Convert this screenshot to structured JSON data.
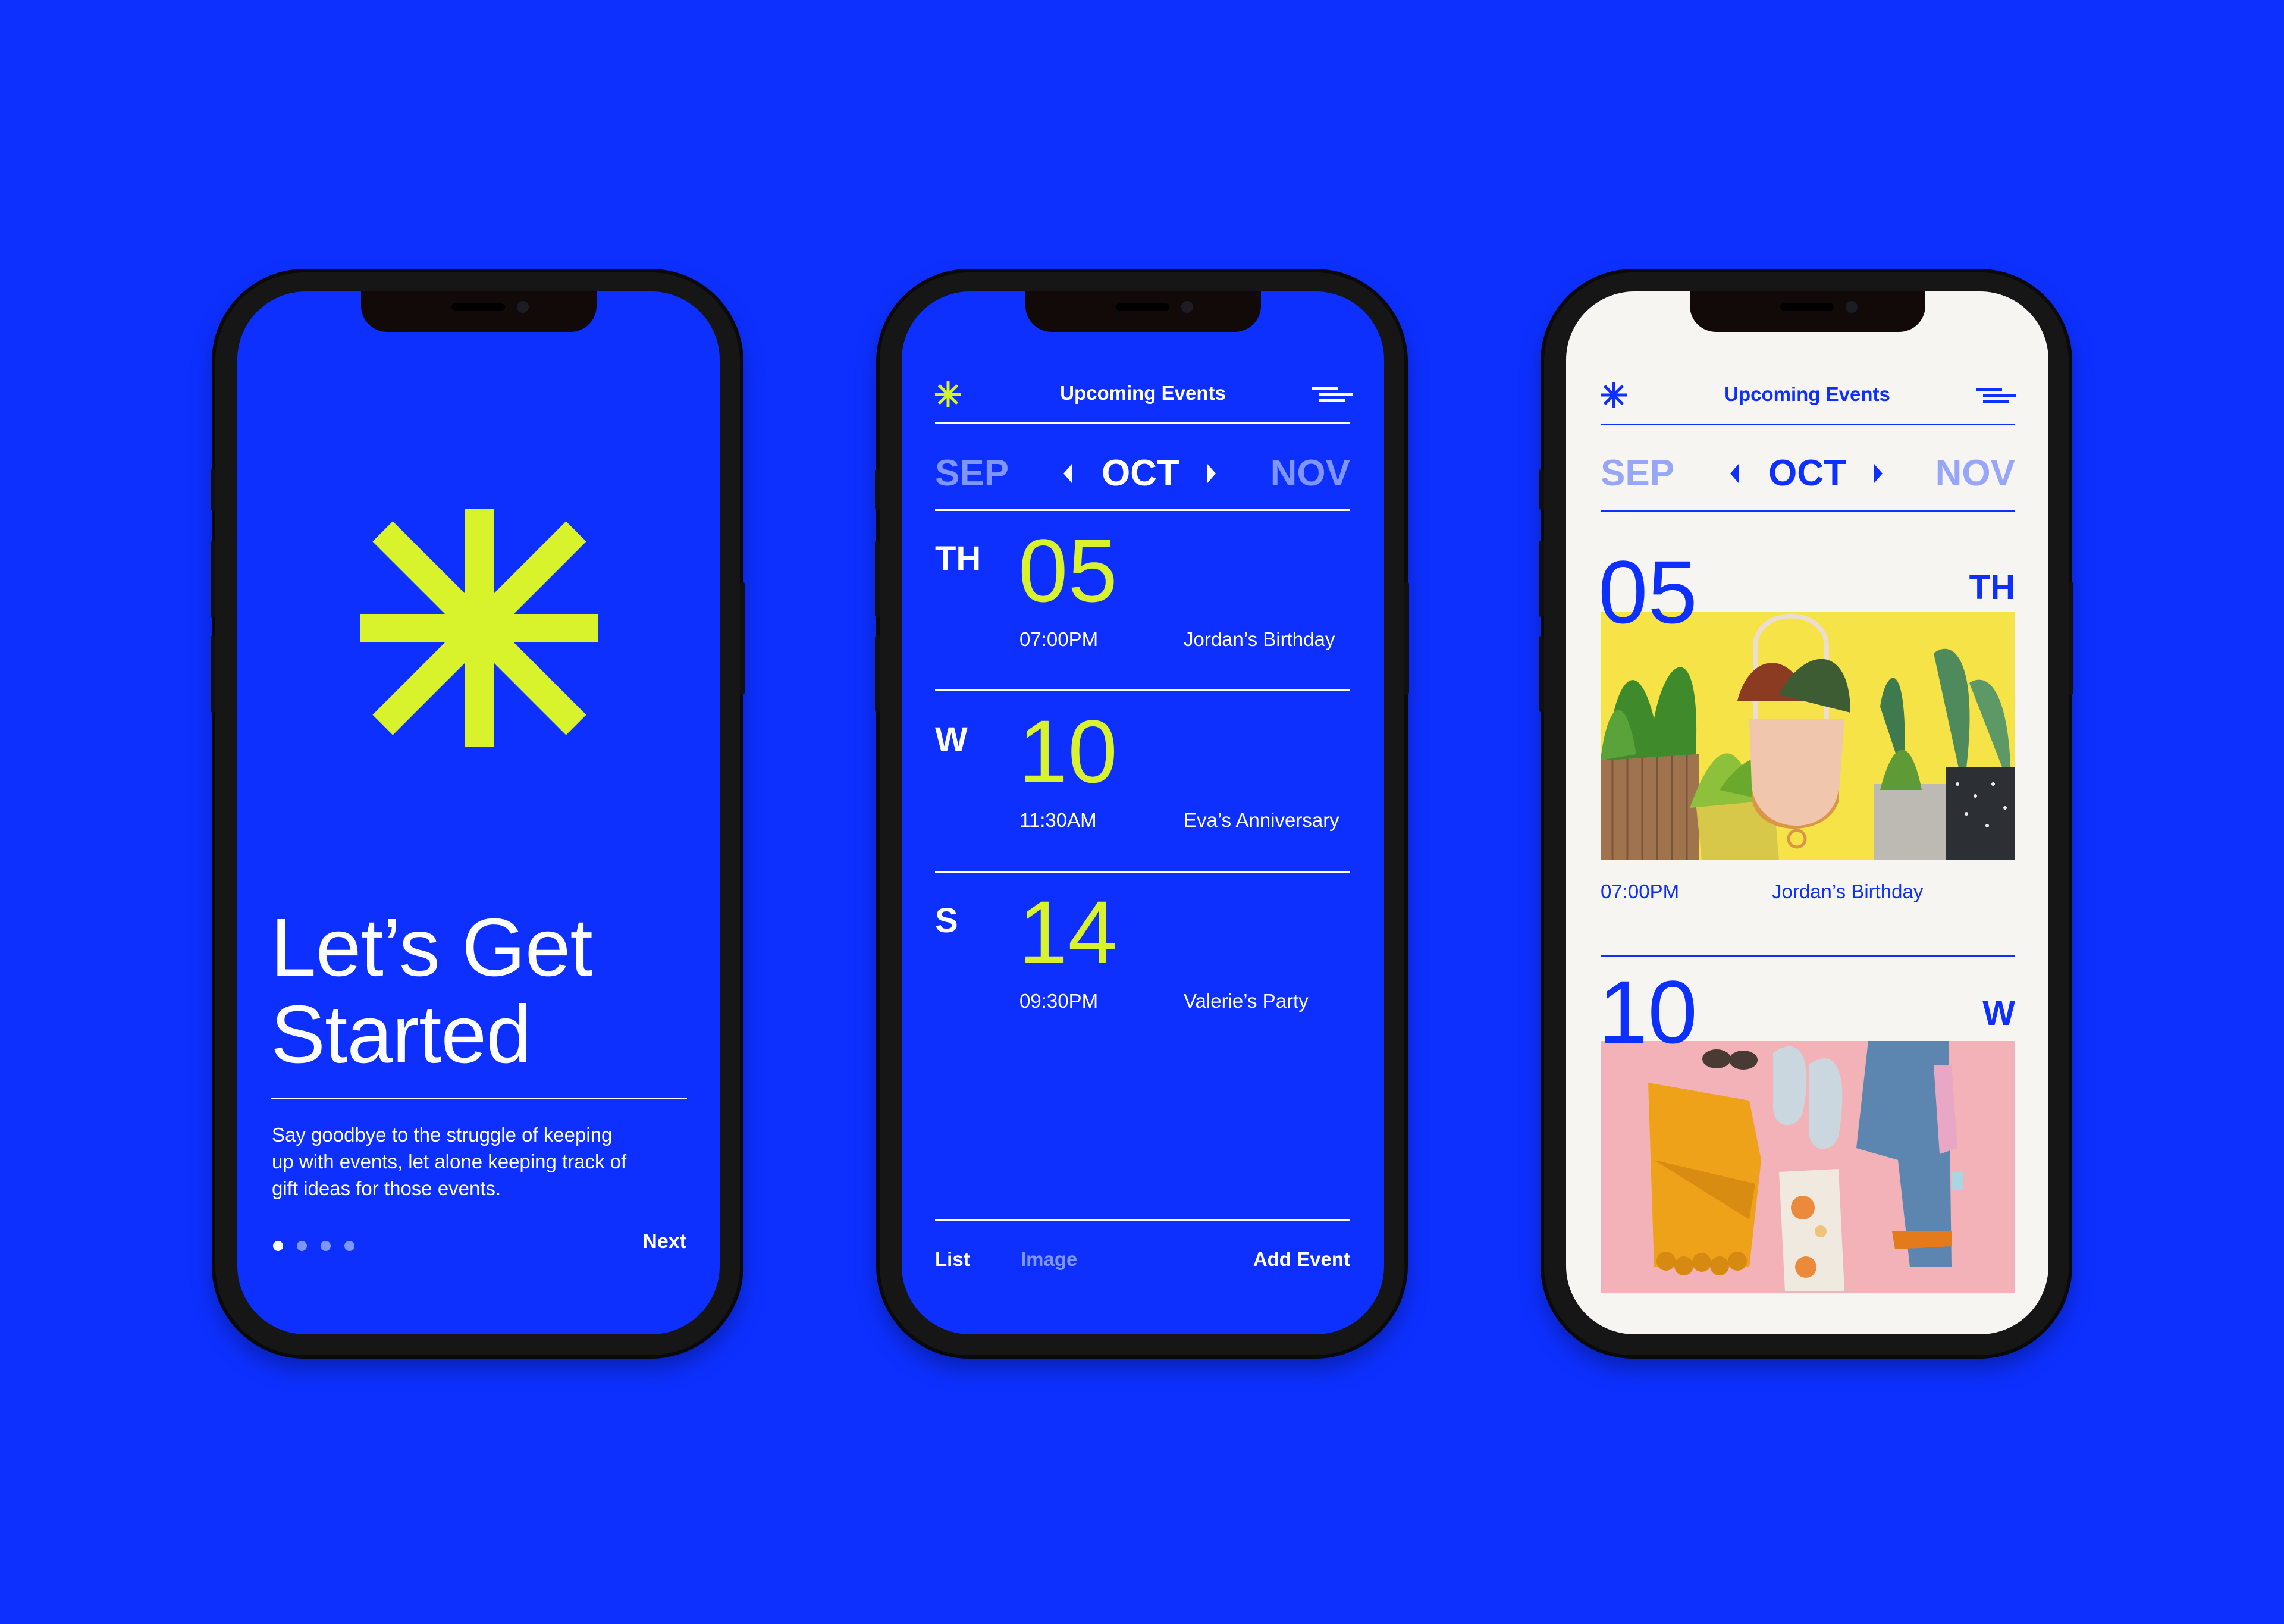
{
  "colors": {
    "background": "#0d30ff",
    "accent_lime": "#d8f22c",
    "cream": "#f7f5f1",
    "white": "#ffffff",
    "dim_month": "#7f95ff"
  },
  "onboarding": {
    "logo_icon": "asterisk-icon",
    "title_line1": "Let’s Get",
    "title_line2": "Started",
    "body_line1": "Say goodbye to the struggle of keeping",
    "body_line2": "up with events, let alone keeping track of",
    "body_line3": "gift ideas for those events.",
    "pagination": {
      "total": 4,
      "active": 1
    },
    "next_label": "Next"
  },
  "list_screen": {
    "header": {
      "logo_icon": "asterisk-icon",
      "title": "Upcoming Events",
      "menu_icon": "menu-icon"
    },
    "months": {
      "prev": "SEP",
      "current": "OCT",
      "next": "NOV"
    },
    "events": [
      {
        "weekday": "TH",
        "day": "05",
        "time": "07:00PM",
        "name": "Jordan’s Birthday"
      },
      {
        "weekday": "W",
        "day": "10",
        "time": "11:30AM",
        "name": "Eva’s Anniversary"
      },
      {
        "weekday": "S",
        "day": "14",
        "time": "09:30PM",
        "name": "Valerie’s Party"
      }
    ],
    "footer": {
      "list_label": "List",
      "image_label": "Image",
      "add_label": "Add Event"
    }
  },
  "image_screen": {
    "header": {
      "logo_icon": "asterisk-icon",
      "title": "Upcoming Events",
      "menu_icon": "menu-icon"
    },
    "months": {
      "prev": "SEP",
      "current": "OCT",
      "next": "NOV"
    },
    "events": [
      {
        "weekday": "TH",
        "day": "05",
        "time": "07:00PM",
        "name": "Jordan’s Birthday",
        "image": "plants-photo"
      },
      {
        "weekday": "W",
        "day": "10",
        "image": "outfit-flatlay-photo"
      }
    ]
  }
}
